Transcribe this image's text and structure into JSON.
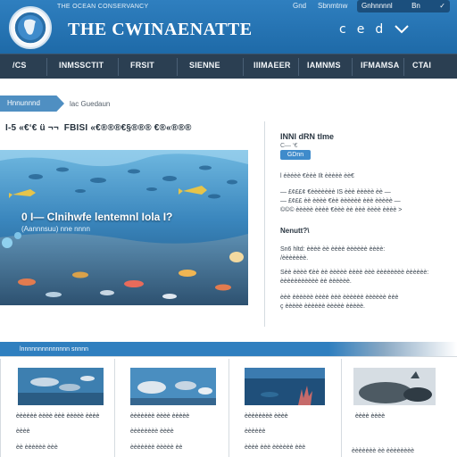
{
  "header": {
    "tagline": "THE OCEAN CONSERVANCY",
    "title": "THE CWINAENATTE",
    "util_left": "Gnd",
    "util_mid": "Sbnmtnw",
    "util_box_label": "Gnhnnnnl",
    "util_box_icon1": "Bn",
    "util_box_icon2": "✓",
    "icons": [
      "search-icon",
      "account-icon",
      "cart-icon",
      "menu-icon"
    ],
    "icon_glyphs": [
      "c",
      "e",
      "d",
      "d"
    ]
  },
  "nav": {
    "items": [
      "/CS",
      "INMSSCTIT",
      "FRSIT",
      "SIENNE",
      "IIIMAEER",
      "IAMNMS",
      "IFMAMSA",
      "CTAI"
    ]
  },
  "breadcrumb": {
    "pill": "Hnnunnnd",
    "text": "lac Guedaun"
  },
  "article": {
    "headline": "I-5 «€‘€ ü ¬¬  FBISI «€®®®€§®®® €®«®®®"
  },
  "hero": {
    "title": "0 I— Clnihwfe lentemnl Iola I?",
    "subtitle": "(Aannnsuu) nne nnnn"
  },
  "sidebar": {
    "title": "INNI dRN tlme",
    "subtitle": "C— ‘€",
    "button": "GDnn",
    "meta": "l éèéèè €èèè Ilt èèèèè èè€",
    "lines1": [
      "— £¢££¢ €èèèèèèè IS èèè èèèèè èè —",
      "— £¢££ èè èèèè €èè èèèèèè èèè èèèèè —",
      "©©© èèèèè èèèè €èèè èè èèè èèèè èèèè >"
    ],
    "section_head": "Nenutt?\\",
    "lines2": [
      "Sn6 hltd: èèèè èè èèèè èèèèèè èèèè:",
      "/èèèèèèè.",
      "Sèè èèèè €èè èè èèèèè èèèè èèè èèèèèèèè èèèèèè:",
      "èèèèèèèèèèè èè èèèèèè.",
      "èèè èèèèèè èèèè èèè èèèèèè èèèèèè èèè",
      "ç èèèèè èèèèèè èèèèè èèèèè."
    ]
  },
  "bottom": {
    "band_label": "lnnnnnnnnnnnnnn snnnn",
    "cards": [
      {
        "title": "èèèèèè èèèè èèè èèèèè èèèè",
        "lines": [
          "èèèè",
          "èè èèèèèè èèè"
        ]
      },
      {
        "title": "èèèèèèè èèèè èèèèè",
        "lines": [
          "èèèèèèèè èèèè",
          "èèèèèèè èèèèè èè"
        ]
      },
      {
        "title": "èèèèèèèè èèèè",
        "lines": [
          "èèèèèè",
          "èèèè èèè èèèèèè èèè"
        ]
      },
      {
        "title": "èèèè èèèè",
        "lines": [
          "èèèèèèè èè èèèèèèèè"
        ]
      }
    ]
  },
  "colors": {
    "header_blue": "#1e6aa8",
    "nav_dark": "#2b3f52",
    "accent": "#3f8bcb"
  }
}
